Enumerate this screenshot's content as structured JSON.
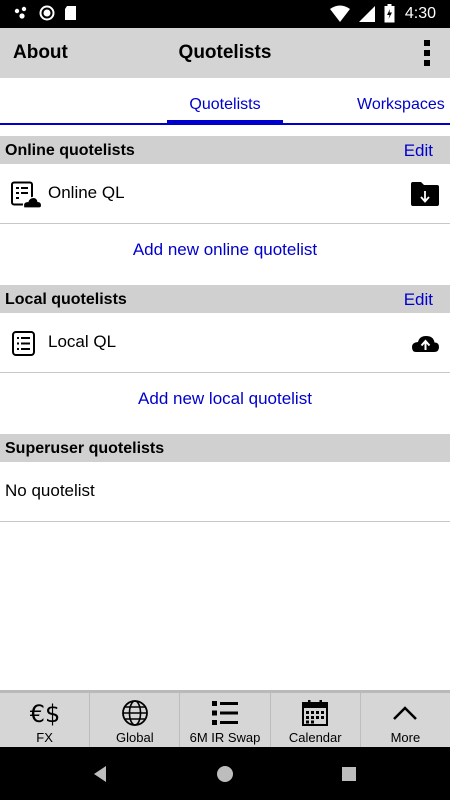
{
  "status_bar": {
    "time": "4:30",
    "icons": [
      "notification-dots-icon",
      "circle-icon",
      "sd-card-icon",
      "wifi-icon",
      "signal-icon",
      "battery-charging-icon"
    ]
  },
  "app_bar": {
    "about_label": "About",
    "title": "Quotelists",
    "menu_icon": "overflow-menu-icon"
  },
  "tabs": [
    {
      "label": "Quotelists",
      "active": true
    },
    {
      "label": "Workspaces",
      "active": false
    }
  ],
  "sections": {
    "online": {
      "title": "Online quotelists",
      "edit_label": "Edit",
      "items": [
        {
          "label": "Online QL",
          "icon": "cloud-list-icon",
          "action_icon": "folder-download-icon"
        }
      ],
      "add_label": "Add new online quotelist"
    },
    "local": {
      "title": "Local quotelists",
      "edit_label": "Edit",
      "items": [
        {
          "label": "Local QL",
          "icon": "list-icon",
          "action_icon": "cloud-upload-icon"
        }
      ],
      "add_label": "Add new local quotelist"
    },
    "superuser": {
      "title": "Superuser quotelists",
      "empty_label": "No quotelist"
    }
  },
  "bottom_nav": [
    {
      "label": "FX",
      "icon": "euro-dollar-icon"
    },
    {
      "label": "Global",
      "icon": "globe-icon"
    },
    {
      "label": "6M IR Swap",
      "icon": "list-bullets-icon"
    },
    {
      "label": "Calendar",
      "icon": "calendar-icon"
    },
    {
      "label": "More",
      "icon": "chevron-up-icon"
    }
  ],
  "colors": {
    "accent": "#0000cc",
    "header_bg": "#d4d4d4",
    "section_bg": "#d0d0d0"
  }
}
